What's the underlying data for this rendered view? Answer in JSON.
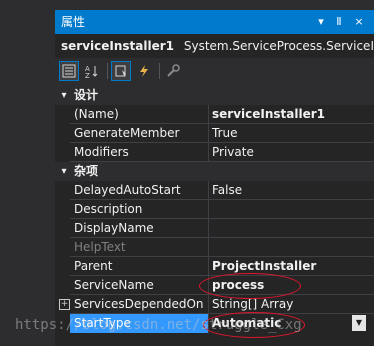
{
  "window": {
    "title": "属性",
    "buttons": [
      "▾",
      "Ⅱ",
      "×"
    ]
  },
  "object_selector": {
    "name": "serviceInstaller1",
    "type": "System.ServiceProcess.ServiceIns"
  },
  "toolbar": {
    "items": [
      "categorized-icon",
      "alphabetical-icon",
      "properties-icon",
      "events-icon",
      "property-pages-icon"
    ]
  },
  "grid": {
    "categories": [
      {
        "label": "设计",
        "toggle": "▾"
      },
      {
        "label": "杂项",
        "toggle": "▾"
      }
    ],
    "rows": [
      {
        "name": "(Name)",
        "value": "serviceInstaller1"
      },
      {
        "name": "GenerateMember",
        "value": "True"
      },
      {
        "name": "Modifiers",
        "value": "Private"
      },
      {
        "name": "DelayedAutoStart",
        "value": "False"
      },
      {
        "name": "Description",
        "value": ""
      },
      {
        "name": "DisplayName",
        "value": ""
      },
      {
        "name": "HelpText",
        "value": ""
      },
      {
        "name": "Parent",
        "value": "ProjectInstaller"
      },
      {
        "name": "ServiceName",
        "value": "process"
      },
      {
        "name": "ServicesDependedOn",
        "value": "String[] Array",
        "expander": "+"
      },
      {
        "name": "StartType",
        "value": "Automatic"
      }
    ]
  },
  "watermark": "https://blog.csdn.net/struggle_Cxg"
}
